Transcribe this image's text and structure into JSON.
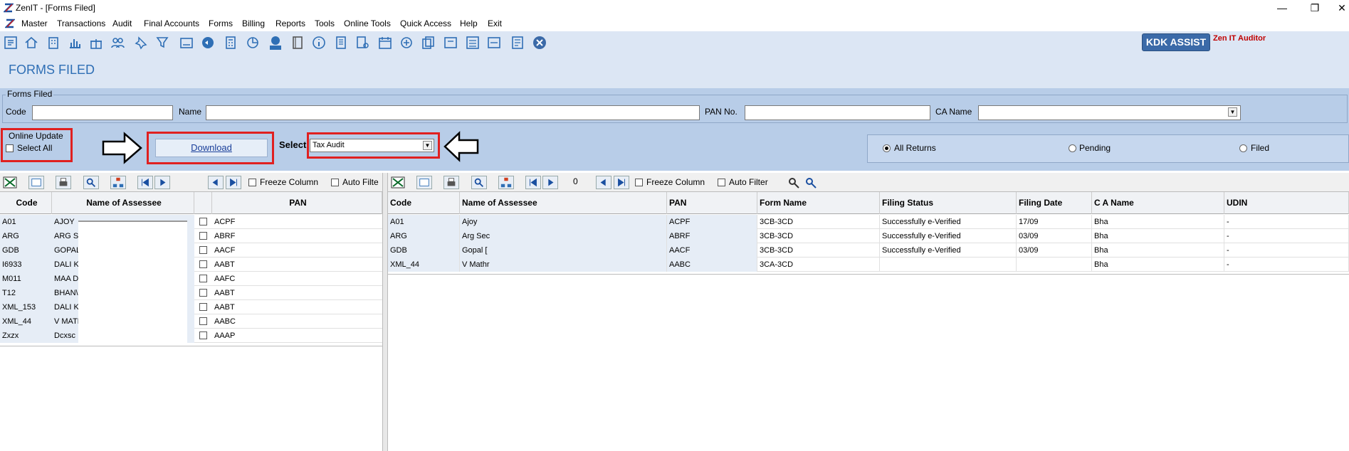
{
  "window": {
    "title": "ZenIT - [Forms Filed]",
    "minimize": "—",
    "restore": "❐",
    "close": "✕"
  },
  "menu": [
    "Master",
    "Transactions",
    "Audit",
    "Final Accounts",
    "Forms",
    "Billing",
    "Reports",
    "Tools",
    "Online Tools",
    "Quick Access",
    "Help",
    "Exit"
  ],
  "toolbar": {
    "kdk_label": "KDK ASSIST",
    "zen_label": "Zen IT Auditor"
  },
  "page_title": "FORMS FILED",
  "filters": {
    "group_label": "Forms Filed",
    "code_label": "Code",
    "code_value": "",
    "name_label": "Name",
    "name_value": "",
    "pan_label": "PAN No.",
    "pan_value": "",
    "ca_label": "CA Name",
    "ca_value": ""
  },
  "online_update": {
    "group_label": "Online Update",
    "select_all_label": "Select All",
    "download_label": "Download",
    "select_label": "Select",
    "select_value": "Tax Audit"
  },
  "returns_filter": {
    "options": [
      "All Returns",
      "Pending",
      "Filed"
    ],
    "selected": "All Returns"
  },
  "left_grid": {
    "freeze_label": "Freeze Column",
    "autofilter_label": "Auto Filte",
    "columns": [
      "Code",
      "Name of Assessee",
      "PAN"
    ],
    "rows": [
      {
        "code": "A01",
        "name": "AJOY",
        "pan": "ACPF"
      },
      {
        "code": "ARG",
        "name": "ARG S",
        "pan": "ABRF"
      },
      {
        "code": "GDB",
        "name": "GOPAL",
        "pan": "AACF"
      },
      {
        "code": "I6933",
        "name": "DALI K",
        "pan": "AABT"
      },
      {
        "code": "M011",
        "name": "MAA DU",
        "pan": "AAFC"
      },
      {
        "code": "T12",
        "name": "BHAN\\",
        "pan": "AABT"
      },
      {
        "code": "XML_153",
        "name": "DALI K",
        "pan": "AABT"
      },
      {
        "code": "XML_44",
        "name": "V MATH",
        "pan": "AABC"
      },
      {
        "code": "Zxzx",
        "name": "Dcxsc",
        "pan": "AAAP"
      }
    ]
  },
  "right_grid": {
    "counter": "0",
    "freeze_label": "Freeze Column",
    "autofilter_label": "Auto Filter",
    "columns": [
      "Code",
      "Name of Assessee",
      "PAN",
      "Form Name",
      "Filing Status",
      "Filing Date",
      "C A Name",
      "UDIN"
    ],
    "rows": [
      {
        "code": "A01",
        "name": "Ajoy",
        "pan": "ACPF",
        "form": "3CB-3CD",
        "status": "Successfully e-Verified",
        "date": "17/09",
        "ca": "Bha",
        "udin": "-"
      },
      {
        "code": "ARG",
        "name": "Arg Sec",
        "pan": "ABRF",
        "form": "3CB-3CD",
        "status": "Successfully e-Verified",
        "date": "03/09",
        "ca": "Bha",
        "udin": "-"
      },
      {
        "code": "GDB",
        "name": "Gopal [",
        "pan": "AACF",
        "form": "3CB-3CD",
        "status": "Successfully e-Verified",
        "date": "03/09",
        "ca": "Bha",
        "udin": "-"
      },
      {
        "code": "XML_44",
        "name": "V Mathr",
        "pan": "AABC",
        "form": "3CA-3CD",
        "status": "",
        "date": "",
        "ca": "Bha",
        "udin": "-"
      }
    ]
  }
}
